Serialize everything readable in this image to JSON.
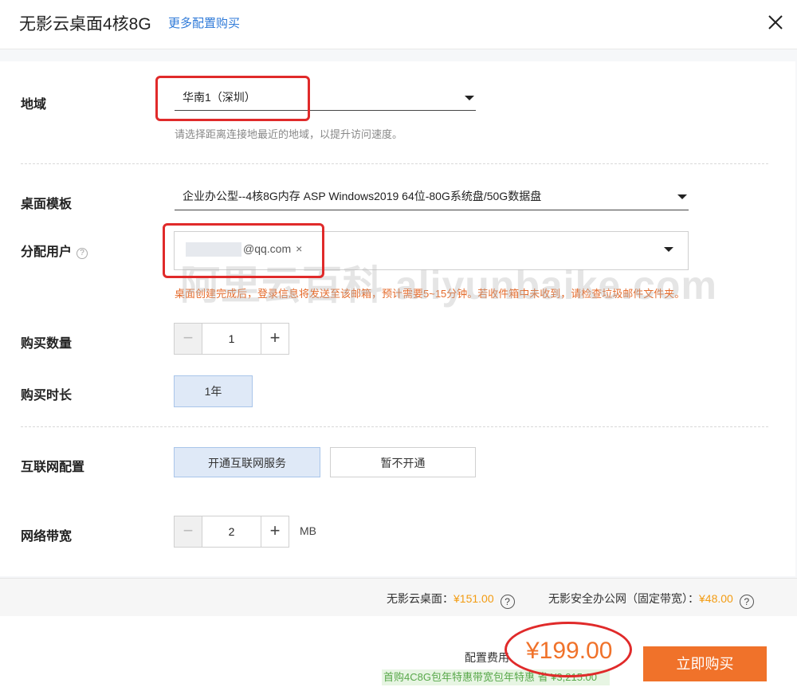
{
  "header": {
    "title": "无影云桌面4核8G",
    "more_link": "更多配置购买"
  },
  "region": {
    "label": "地域",
    "value": "华南1（深圳）",
    "hint": "请选择距离连接地最近的地域，以提升访问速度。"
  },
  "template": {
    "label": "桌面模板",
    "value": "企业办公型--4核8G内存 ASP Windows2019 64位-80G系统盘/50G数据盘"
  },
  "assign_user": {
    "label": "分配用户",
    "help": "?",
    "tag": "@qq.com",
    "tag_close": "×",
    "warning": "桌面创建完成后，登录信息将发送至该邮箱，预计需要5~15分钟。若收件箱中未收到，请检查垃圾邮件文件夹。"
  },
  "quantity": {
    "label": "购买数量",
    "minus": "−",
    "value": "1",
    "plus": "+"
  },
  "duration": {
    "label": "购买时长",
    "option": "1年"
  },
  "internet": {
    "label": "互联网配置",
    "options": [
      "开通互联网服务",
      "暂不开通"
    ]
  },
  "bandwidth": {
    "label": "网络带宽",
    "minus": "−",
    "value": "2",
    "plus": "+",
    "unit": "MB"
  },
  "watermark": "阿里云百科 aliyunbaike.com",
  "summary": {
    "desktop_label": "无影云桌面：",
    "desktop_price": "¥151.00",
    "network_label": "无影安全办公网（固定带宽）：",
    "network_price": "¥48.00",
    "help": "?"
  },
  "footer": {
    "fee_label": "配置费用",
    "total": "¥199.00",
    "promo": "首购4C8G包年特惠带宽包年特惠 省 ¥3,215.00",
    "buy_button": "立即购买"
  },
  "colors": {
    "accent": "#f0722a",
    "link": "#2f7ad8",
    "selected_bg": "#dfe9f7",
    "warning": "#e46a2a",
    "annotation_red": "#e02a2a"
  }
}
